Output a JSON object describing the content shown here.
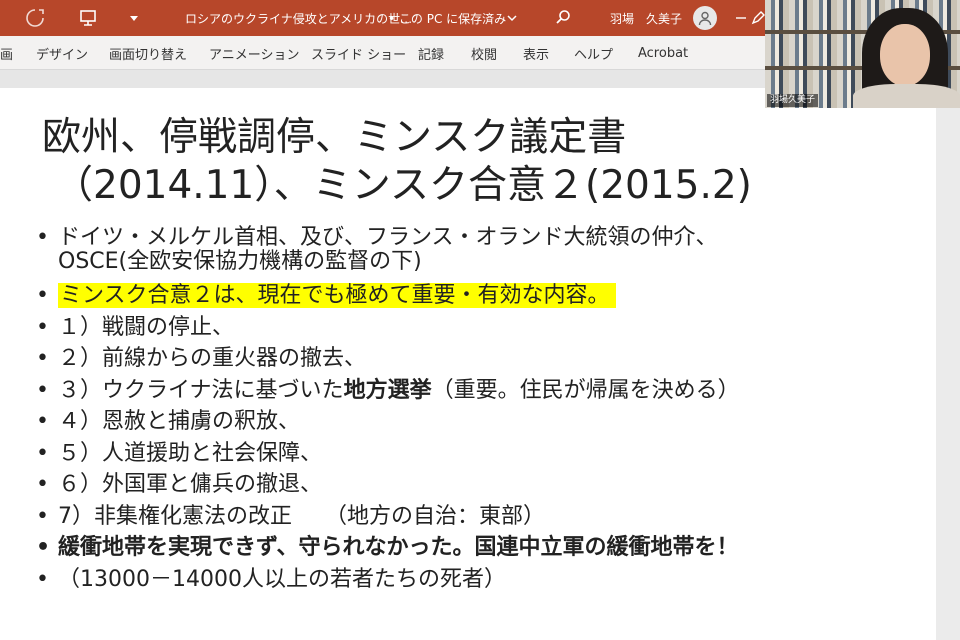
{
  "titlebar": {
    "doc_title": "ロシアのウクライナ侵攻とアメリカの世…",
    "save_status": "• この PC に保存済み",
    "user_name": "羽場　久美子",
    "color": "#b7472a"
  },
  "ribbon": {
    "tabs": [
      "画",
      "デザイン",
      "画面切り替え",
      "アニメーション",
      "スライド ショー",
      "記録",
      "校閲",
      "表示",
      "ヘルプ",
      "Acrobat"
    ]
  },
  "slide": {
    "title_line1": "欧州、停戦調停、ミンスク議定書",
    "title_line2": "（2014.11）、ミンスク合意２(2015.2)",
    "bullet_char": "•",
    "bullets": {
      "b0_line1": "ドイツ・メルケル首相、及び、フランス・オランド大統領の仲介、",
      "b0_line2": "OSCE(全欧安保協力機構の監督の下)",
      "b1": "ミンスク合意２は、現在でも極めて重要・有効な内容。",
      "b2": "１）戦闘の停止、",
      "b3": "２）前線からの重火器の撤去、",
      "b4_pre": "３）ウクライナ法に基づいた",
      "b4_bold": "地方選挙",
      "b4_post": "（重要。住民が帰属を決める）",
      "b5": "４）恩赦と捕虜の釈放、",
      "b6": "５）人道援助と社会保障、",
      "b7": "６）外国軍と傭兵の撤退、",
      "b8": "7）非集権化憲法の改正　　（地方の自治：東部）",
      "b9": "緩衝地帯を実現できず、守られなかった。国連中立軍の緩衝地帯を！",
      "b10": "（13000－14000人以上の若者たちの死者）"
    },
    "highlight_color": "#ffff00"
  },
  "webcam": {
    "participant_name": "羽場久美子"
  }
}
